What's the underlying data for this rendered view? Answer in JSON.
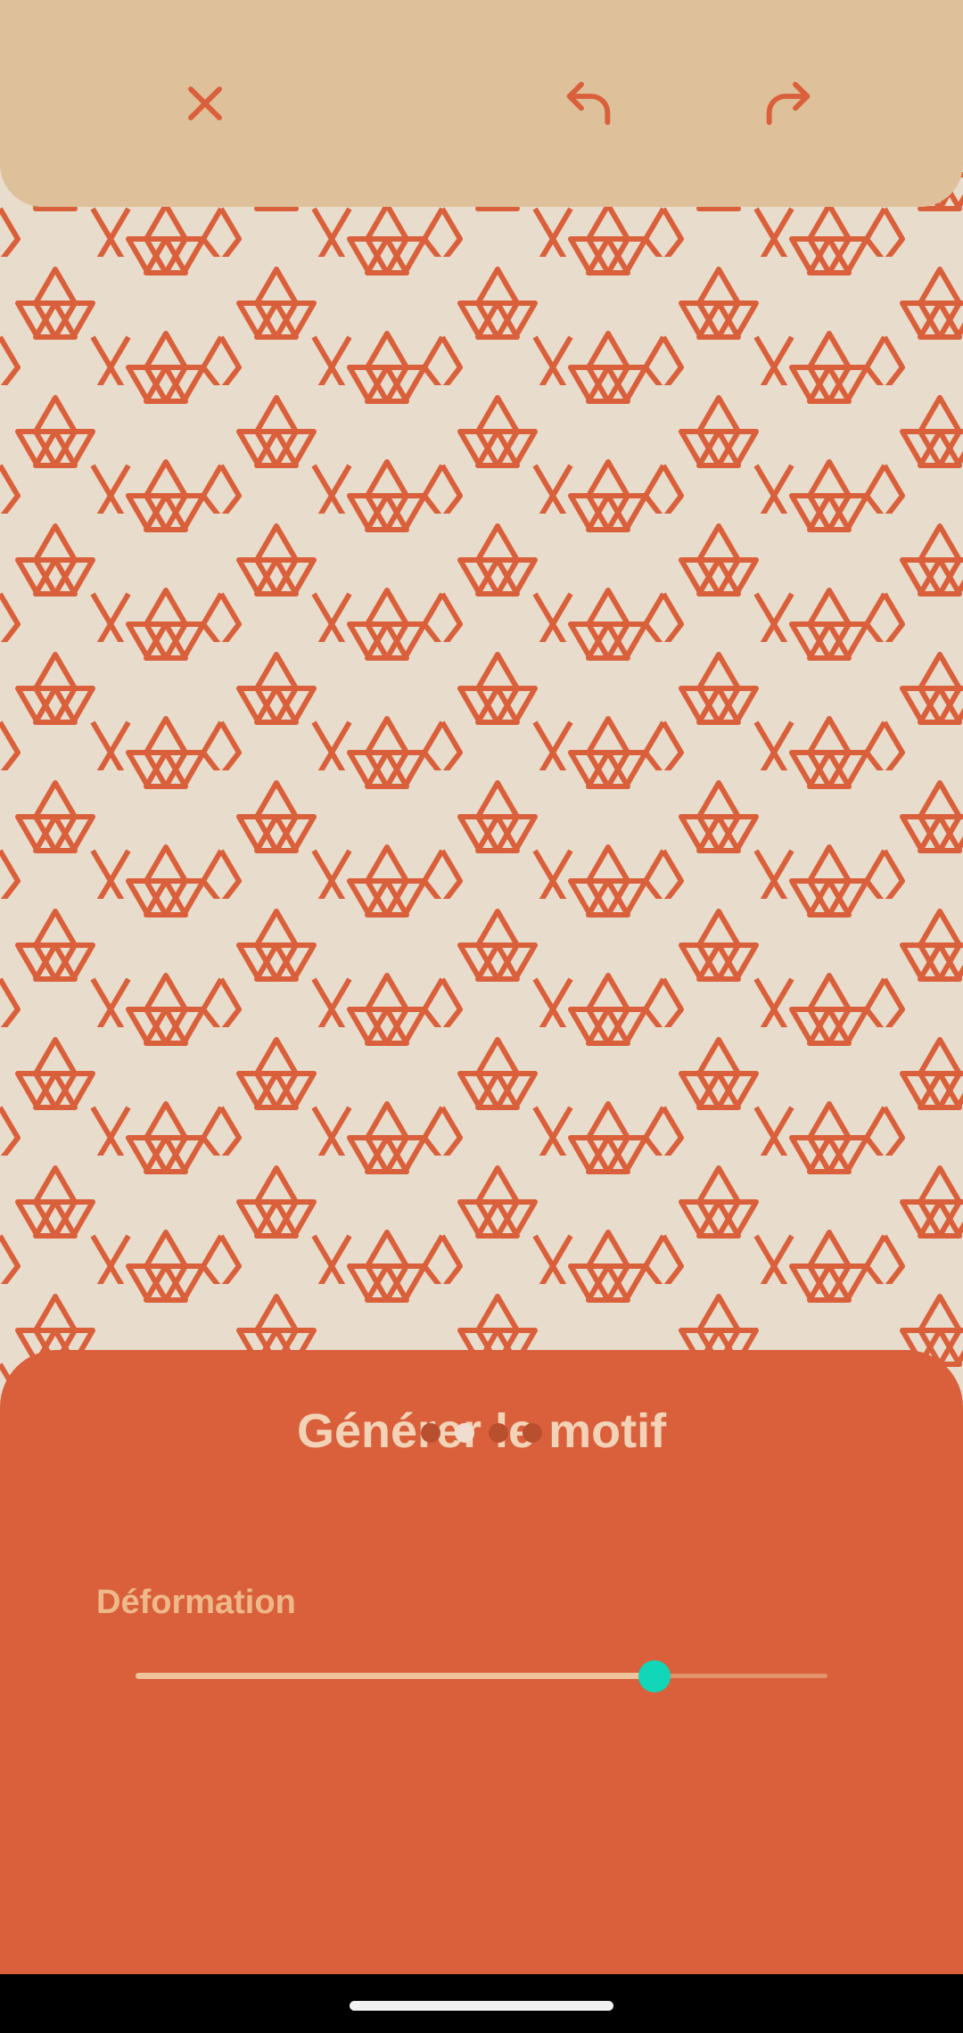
{
  "screen": {
    "colors": {
      "background": "#e8dccd",
      "pattern_stroke": "#d9603a",
      "top_bar": "#dec09a",
      "sheet": "#d9603a",
      "accent": "#11d6b8"
    }
  },
  "top_bar": {
    "close_icon": "close-icon",
    "undo_icon": "undo-icon",
    "redo_icon": "redo-icon"
  },
  "sheet": {
    "title": "Générer le motif",
    "slider": {
      "label": "Déformation",
      "value_percent": 75
    },
    "pager": {
      "count": 4,
      "active_index": 1
    }
  }
}
